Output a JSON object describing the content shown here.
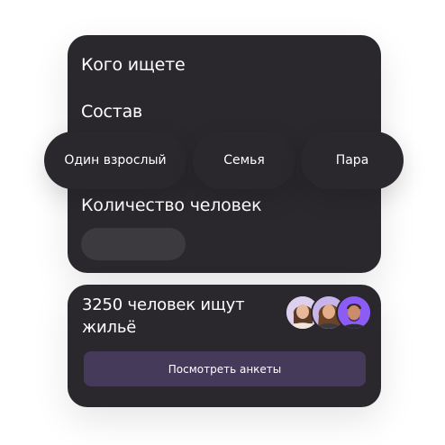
{
  "filters": {
    "who_heading": "Кого ищете",
    "composition_heading": "Состав",
    "options": [
      {
        "label": "Один взрослый"
      },
      {
        "label": "Семья"
      },
      {
        "label": "Пара"
      }
    ],
    "count_heading": "Количество человек",
    "count_value": ""
  },
  "seekers": {
    "title": "3250 человек ищут жильё",
    "avatars": [
      "avatar-woman-1",
      "avatar-woman-2",
      "avatar-man"
    ],
    "button_label": "Посмотреть анкеты"
  },
  "colors": {
    "card_background": "#2a282c",
    "button_background": "#463a5a",
    "avatar_accent": "#8b5cf6"
  }
}
